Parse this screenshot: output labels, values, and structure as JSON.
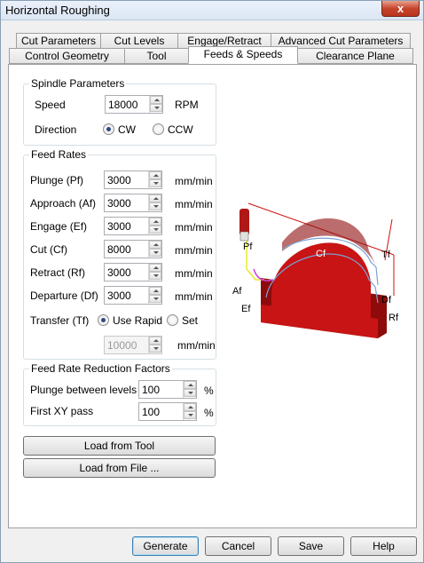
{
  "window": {
    "title": "Horizontal Roughing",
    "close_glyph": "x"
  },
  "tabs_row1": [
    "Cut Parameters",
    "Cut Levels",
    "Engage/Retract",
    "Advanced Cut Parameters"
  ],
  "tabs_row2": [
    "Control Geometry",
    "Tool",
    "Feeds & Speeds",
    "Clearance Plane"
  ],
  "active_tab": "Feeds & Speeds",
  "spindle": {
    "title": "Spindle Parameters",
    "speed_label": "Speed",
    "speed_value": "18000",
    "speed_unit": "RPM",
    "direction_label": "Direction",
    "cw_label": "CW",
    "ccw_label": "CCW",
    "direction_selected": "CW"
  },
  "feed_rates": {
    "title": "Feed Rates",
    "rows": [
      {
        "label": "Plunge (Pf)",
        "value": "3000",
        "unit": "mm/min"
      },
      {
        "label": "Approach (Af)",
        "value": "3000",
        "unit": "mm/min"
      },
      {
        "label": "Engage (Ef)",
        "value": "3000",
        "unit": "mm/min"
      },
      {
        "label": "Cut (Cf)",
        "value": "8000",
        "unit": "mm/min"
      },
      {
        "label": "Retract (Rf)",
        "value": "3000",
        "unit": "mm/min"
      },
      {
        "label": "Departure  (Df)",
        "value": "3000",
        "unit": "mm/min"
      }
    ],
    "transfer_label": "Transfer (Tf)",
    "use_rapid_label": "Use Rapid",
    "set_label": "Set",
    "transfer_selected": "Use Rapid",
    "transfer_value": "10000",
    "transfer_unit": "mm/min"
  },
  "reduction": {
    "title": "Feed Rate Reduction Factors",
    "plunge_label": "Plunge between levels",
    "plunge_value": "100",
    "plunge_unit": "%",
    "first_xy_label": "First XY pass",
    "first_xy_value": "100",
    "first_xy_unit": "%"
  },
  "buttons": {
    "load_tool": "Load from Tool",
    "load_file": "Load from File ...",
    "generate": "Generate",
    "cancel": "Cancel",
    "save": "Save",
    "help": "Help"
  },
  "diagram": {
    "labels": {
      "pf": "Pf",
      "af": "Af",
      "ef": "Ef",
      "cf": "Cf",
      "tf": "Tf",
      "df": "Df",
      "rf": "Rf"
    },
    "colors": {
      "block": "#c81414",
      "block_dark": "#8e0b0b",
      "tool": "#b01818",
      "toolpath": "#7ba1d6",
      "plunge_line": "#e8e830",
      "engage_line": "#d040d0",
      "frame_line": "#d01010"
    }
  }
}
